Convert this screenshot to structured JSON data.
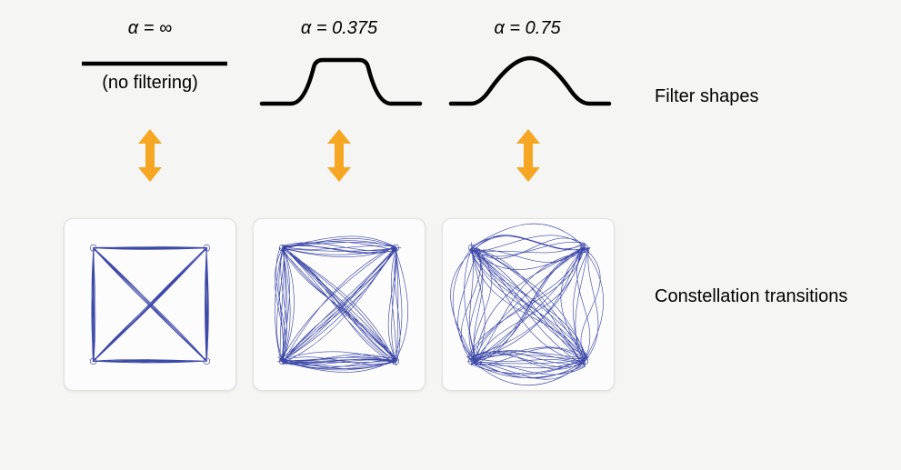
{
  "columns": [
    {
      "alpha_label": "α = ∞",
      "sub_label": "(no filtering)"
    },
    {
      "alpha_label": "α = 0.375",
      "sub_label": ""
    },
    {
      "alpha_label": "α = 0.75",
      "sub_label": ""
    }
  ],
  "row_labels": {
    "filters": "Filter shapes",
    "constellations": "Constellation transitions"
  },
  "colors": {
    "arrow": "#f5a623",
    "trace": "#28359e",
    "filter_stroke": "#000000"
  }
}
